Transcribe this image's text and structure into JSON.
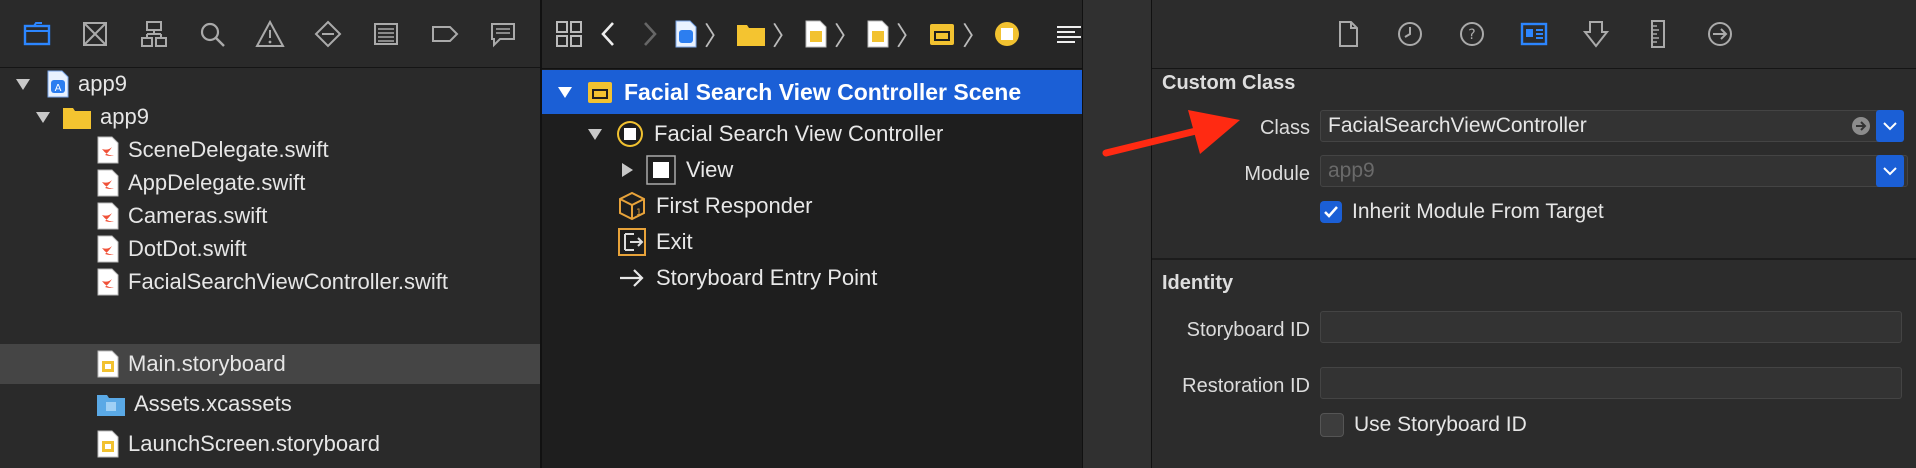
{
  "navigator": {
    "toolbar_icons": [
      "folder-icon",
      "source-control-icon",
      "hierarchy-icon",
      "search-icon",
      "warning-icon",
      "test-icon",
      "debug-icon",
      "breakpoint-icon",
      "report-icon"
    ],
    "items": [
      {
        "label": "app9",
        "level": 0,
        "icon": "app-project-icon",
        "disclosure": "open"
      },
      {
        "label": "app9",
        "level": 1,
        "icon": "folder-icon",
        "disclosure": "open"
      },
      {
        "label": "SceneDelegate.swift",
        "level": 2,
        "icon": "swift-file-icon"
      },
      {
        "label": "AppDelegate.swift",
        "level": 2,
        "icon": "swift-file-icon"
      },
      {
        "label": "Cameras.swift",
        "level": 2,
        "icon": "swift-file-icon"
      },
      {
        "label": "DotDot.swift",
        "level": 2,
        "icon": "swift-file-icon"
      },
      {
        "label": "FacialSearchViewController.swift",
        "level": 2,
        "icon": "swift-file-icon"
      },
      {
        "label": "Main.storyboard",
        "level": 2,
        "icon": "storyboard-file-icon",
        "selected": true
      },
      {
        "label": "Assets.xcassets",
        "level": 2,
        "icon": "assets-folder-icon"
      },
      {
        "label": "LaunchScreen.storyboard",
        "level": 2,
        "icon": "storyboard-file-icon"
      }
    ]
  },
  "outline": {
    "scene_label": "Facial Search View Controller Scene",
    "rows": [
      {
        "label": "Facial Search View Controller",
        "icon": "view-controller-icon"
      },
      {
        "label": "View",
        "icon": "view-icon"
      },
      {
        "label": "First Responder",
        "icon": "first-responder-icon"
      },
      {
        "label": "Exit",
        "icon": "exit-icon"
      },
      {
        "label": "Storyboard Entry Point",
        "icon": "arrow-right-icon"
      }
    ]
  },
  "inspector": {
    "custom_class": {
      "title": "Custom Class",
      "class_label": "Class",
      "class_value": "FacialSearchViewController",
      "module_label": "Module",
      "module_placeholder": "app9",
      "inherit_label": "Inherit Module From Target",
      "inherit_checked": true
    },
    "identity": {
      "title": "Identity",
      "storyboard_id_label": "Storyboard ID",
      "storyboard_id_value": "",
      "restoration_id_label": "Restoration ID",
      "restoration_id_value": "",
      "use_storyboard_label": "Use Storyboard ID",
      "use_storyboard_checked": false
    }
  },
  "colors": {
    "accent": "#1b5fd6",
    "annotation_arrow": "#ff2a12",
    "storyboard_yellow": "#f2c230",
    "folder_blue": "#5aa9e6"
  }
}
